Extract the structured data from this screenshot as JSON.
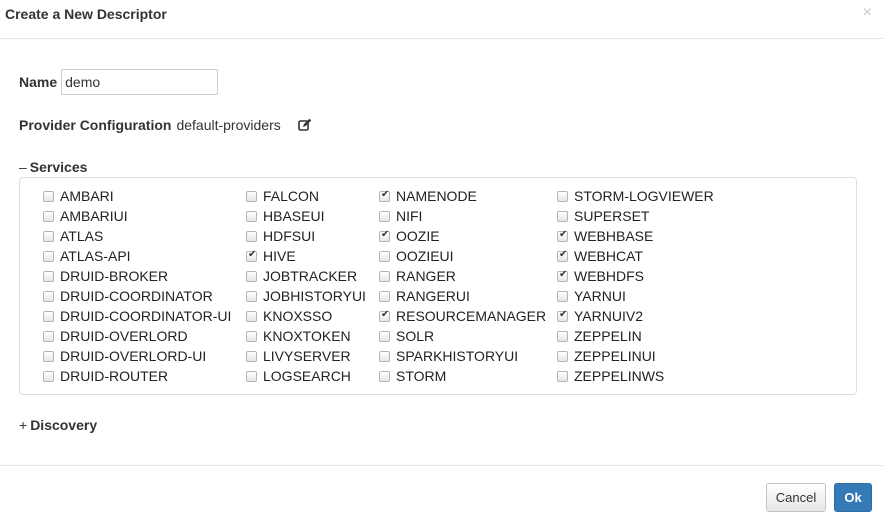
{
  "dialog": {
    "title": "Create a New Descriptor",
    "close_label": "×"
  },
  "name_field": {
    "label": "Name",
    "value": "demo"
  },
  "provider": {
    "label": "Provider Configuration",
    "value": "default-providers",
    "edit_icon": "edit-icon"
  },
  "services": {
    "toggle": "–",
    "label": "Services",
    "columns": [
      [
        {
          "label": "AMBARI",
          "checked": false
        },
        {
          "label": "AMBARIUI",
          "checked": false
        },
        {
          "label": "ATLAS",
          "checked": false
        },
        {
          "label": "ATLAS-API",
          "checked": false
        },
        {
          "label": "DRUID-BROKER",
          "checked": false
        },
        {
          "label": "DRUID-COORDINATOR",
          "checked": false
        },
        {
          "label": "DRUID-COORDINATOR-UI",
          "checked": false
        },
        {
          "label": "DRUID-OVERLORD",
          "checked": false
        },
        {
          "label": "DRUID-OVERLORD-UI",
          "checked": false
        },
        {
          "label": "DRUID-ROUTER",
          "checked": false
        }
      ],
      [
        {
          "label": "FALCON",
          "checked": false
        },
        {
          "label": "HBASEUI",
          "checked": false
        },
        {
          "label": "HDFSUI",
          "checked": false
        },
        {
          "label": "HIVE",
          "checked": true
        },
        {
          "label": "JOBTRACKER",
          "checked": false
        },
        {
          "label": "JOBHISTORYUI",
          "checked": false
        },
        {
          "label": "KNOXSSO",
          "checked": false
        },
        {
          "label": "KNOXTOKEN",
          "checked": false
        },
        {
          "label": "LIVYSERVER",
          "checked": false
        },
        {
          "label": "LOGSEARCH",
          "checked": false
        }
      ],
      [
        {
          "label": "NAMENODE",
          "checked": true
        },
        {
          "label": "NIFI",
          "checked": false
        },
        {
          "label": "OOZIE",
          "checked": true
        },
        {
          "label": "OOZIEUI",
          "checked": false
        },
        {
          "label": "RANGER",
          "checked": false
        },
        {
          "label": "RANGERUI",
          "checked": false
        },
        {
          "label": "RESOURCEMANAGER",
          "checked": true
        },
        {
          "label": "SOLR",
          "checked": false
        },
        {
          "label": "SPARKHISTORYUI",
          "checked": false
        },
        {
          "label": "STORM",
          "checked": false
        }
      ],
      [
        {
          "label": "STORM-LOGVIEWER",
          "checked": false
        },
        {
          "label": "SUPERSET",
          "checked": false
        },
        {
          "label": "WEBHBASE",
          "checked": true
        },
        {
          "label": "WEBHCAT",
          "checked": true
        },
        {
          "label": "WEBHDFS",
          "checked": true
        },
        {
          "label": "YARNUI",
          "checked": false
        },
        {
          "label": "YARNUIV2",
          "checked": true
        },
        {
          "label": "ZEPPELIN",
          "checked": false
        },
        {
          "label": "ZEPPELINUI",
          "checked": false
        },
        {
          "label": "ZEPPELINWS",
          "checked": false
        }
      ]
    ]
  },
  "discovery": {
    "toggle": "+",
    "label": "Discovery"
  },
  "footer": {
    "cancel_label": "Cancel",
    "ok_label": "Ok"
  },
  "colors": {
    "primary": "#337ab7",
    "border": "#dddddd"
  }
}
